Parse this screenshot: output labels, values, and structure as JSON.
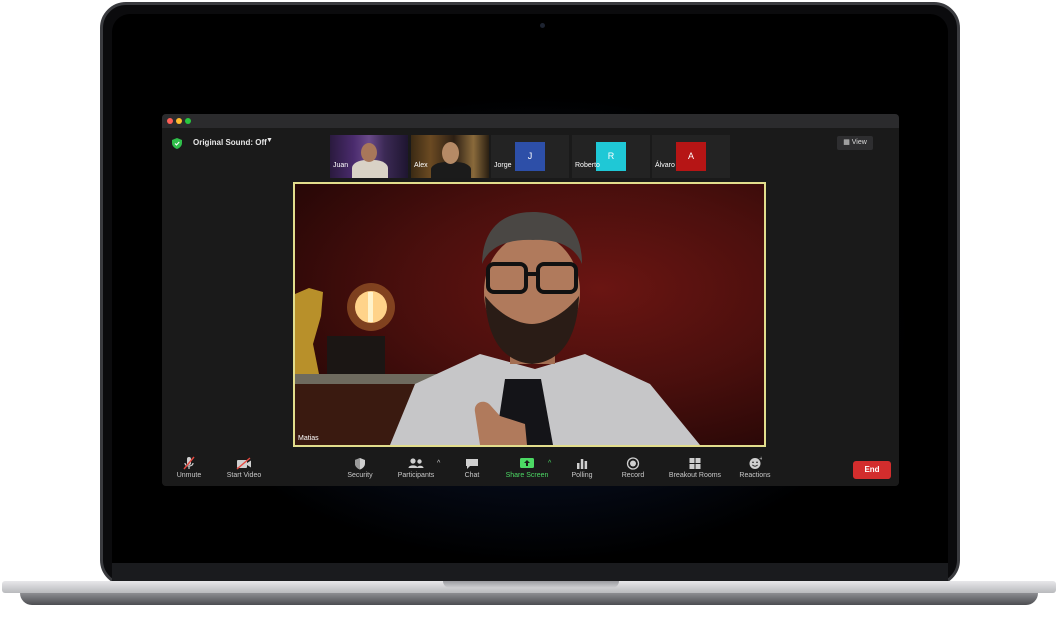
{
  "header": {
    "sound_label": "Original Sound: Off",
    "view_label": "View"
  },
  "participants": [
    {
      "name": "Juan"
    },
    {
      "name": "Alex"
    },
    {
      "name": "Jorge",
      "initial": "J",
      "color": "#2d4fa8"
    },
    {
      "name": "Roberto",
      "initial": "R",
      "color": "#1fc8d6"
    },
    {
      "name": "Álvaro",
      "initial": "A",
      "color": "#b61515"
    }
  ],
  "main_video": {
    "name": "Matias"
  },
  "toolbar": {
    "unmute": "Unmute",
    "start_video": "Start Video",
    "security": "Security",
    "participants": "Participants",
    "chat": "Chat",
    "share_screen": "Share Screen",
    "polling": "Polling",
    "record": "Record",
    "breakout_rooms": "Breakout Rooms",
    "reactions": "Reactions",
    "end": "End"
  },
  "colors": {
    "speaker_border": "#e2dd8c",
    "end_button": "#d32d2d",
    "share_screen": "#4cd964"
  }
}
